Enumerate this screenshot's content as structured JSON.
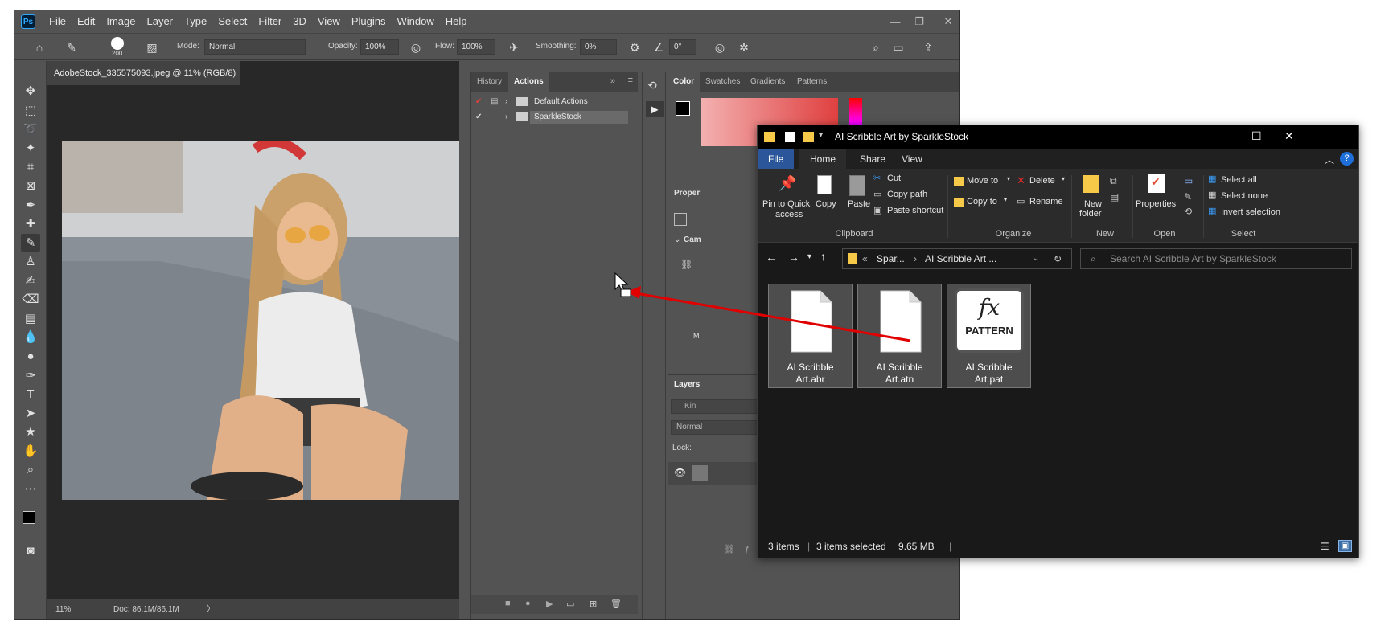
{
  "photoshop": {
    "logo": "Ps",
    "menu": [
      "File",
      "Edit",
      "Image",
      "Layer",
      "Type",
      "Select",
      "Filter",
      "3D",
      "View",
      "Plugins",
      "Window",
      "Help"
    ],
    "options": {
      "brush_size": "200",
      "mode_label": "Mode:",
      "mode_value": "Normal",
      "opacity_label": "Opacity:",
      "opacity_value": "100%",
      "flow_label": "Flow:",
      "flow_value": "100%",
      "smoothing_label": "Smoothing:",
      "smoothing_value": "0%",
      "angle_value": "0°"
    },
    "document": {
      "tab_title": "AdobeStock_335575093.jpeg @ 11% (RGB/8)",
      "zoom": "11%",
      "doc_size": "Doc: 86.1M/86.1M"
    },
    "actions_panel": {
      "tabs": [
        "History",
        "Actions"
      ],
      "active_tab": "Actions",
      "items": [
        {
          "label": "Default Actions"
        },
        {
          "label": "SparkleStock"
        }
      ]
    },
    "color_panel": {
      "tabs": [
        "Color",
        "Swatches",
        "Gradients",
        "Patterns"
      ]
    },
    "properties_panel": {
      "title": "Proper",
      "section": "Cam",
      "misc": "M"
    },
    "layers_panel": {
      "title": "Layers",
      "search_placeholder": "Kin",
      "blend": "Normal",
      "lock_label": "Lock:"
    }
  },
  "explorer": {
    "title": "AI Scribble Art by SparkleStock",
    "tabs": [
      "File",
      "Home",
      "Share",
      "View"
    ],
    "active_tab": "Home",
    "ribbon": {
      "clipboard": {
        "pin_label_1": "Pin to Quick",
        "pin_label_2": "access",
        "copy": "Copy",
        "paste": "Paste",
        "cut": "Cut",
        "copy_path": "Copy path",
        "paste_shortcut": "Paste shortcut",
        "group": "Clipboard"
      },
      "organize": {
        "move_to": "Move to",
        "copy_to": "Copy to",
        "delete": "Delete",
        "rename": "Rename",
        "group": "Organize"
      },
      "new": {
        "new_folder_1": "New",
        "new_folder_2": "folder",
        "group": "New"
      },
      "open": {
        "properties": "Properties",
        "group": "Open"
      },
      "select": {
        "select_all": "Select all",
        "select_none": "Select none",
        "invert_selection": "Invert selection",
        "group": "Select"
      }
    },
    "address": {
      "crumb_1": "Spar...",
      "crumb_2": "AI Scribble Art ...",
      "search_placeholder": "Search AI Scribble Art by SparkleStock"
    },
    "files": [
      {
        "name_line1": "AI Scribble",
        "name_line2": "Art.abr",
        "kind": "blank"
      },
      {
        "name_line1": "AI Scribble",
        "name_line2": "Art.atn",
        "kind": "blank"
      },
      {
        "name_line1": "AI Scribble",
        "name_line2": "Art.pat",
        "kind": "pattern",
        "icon_fx": "fx",
        "icon_label": "PATTERN"
      }
    ],
    "status": {
      "count": "3 items",
      "selected": "3 items selected",
      "size": "9.65 MB"
    }
  },
  "colors": {
    "drag_arrow": "#e00000",
    "explorer_file_tab": "#2b579a"
  }
}
